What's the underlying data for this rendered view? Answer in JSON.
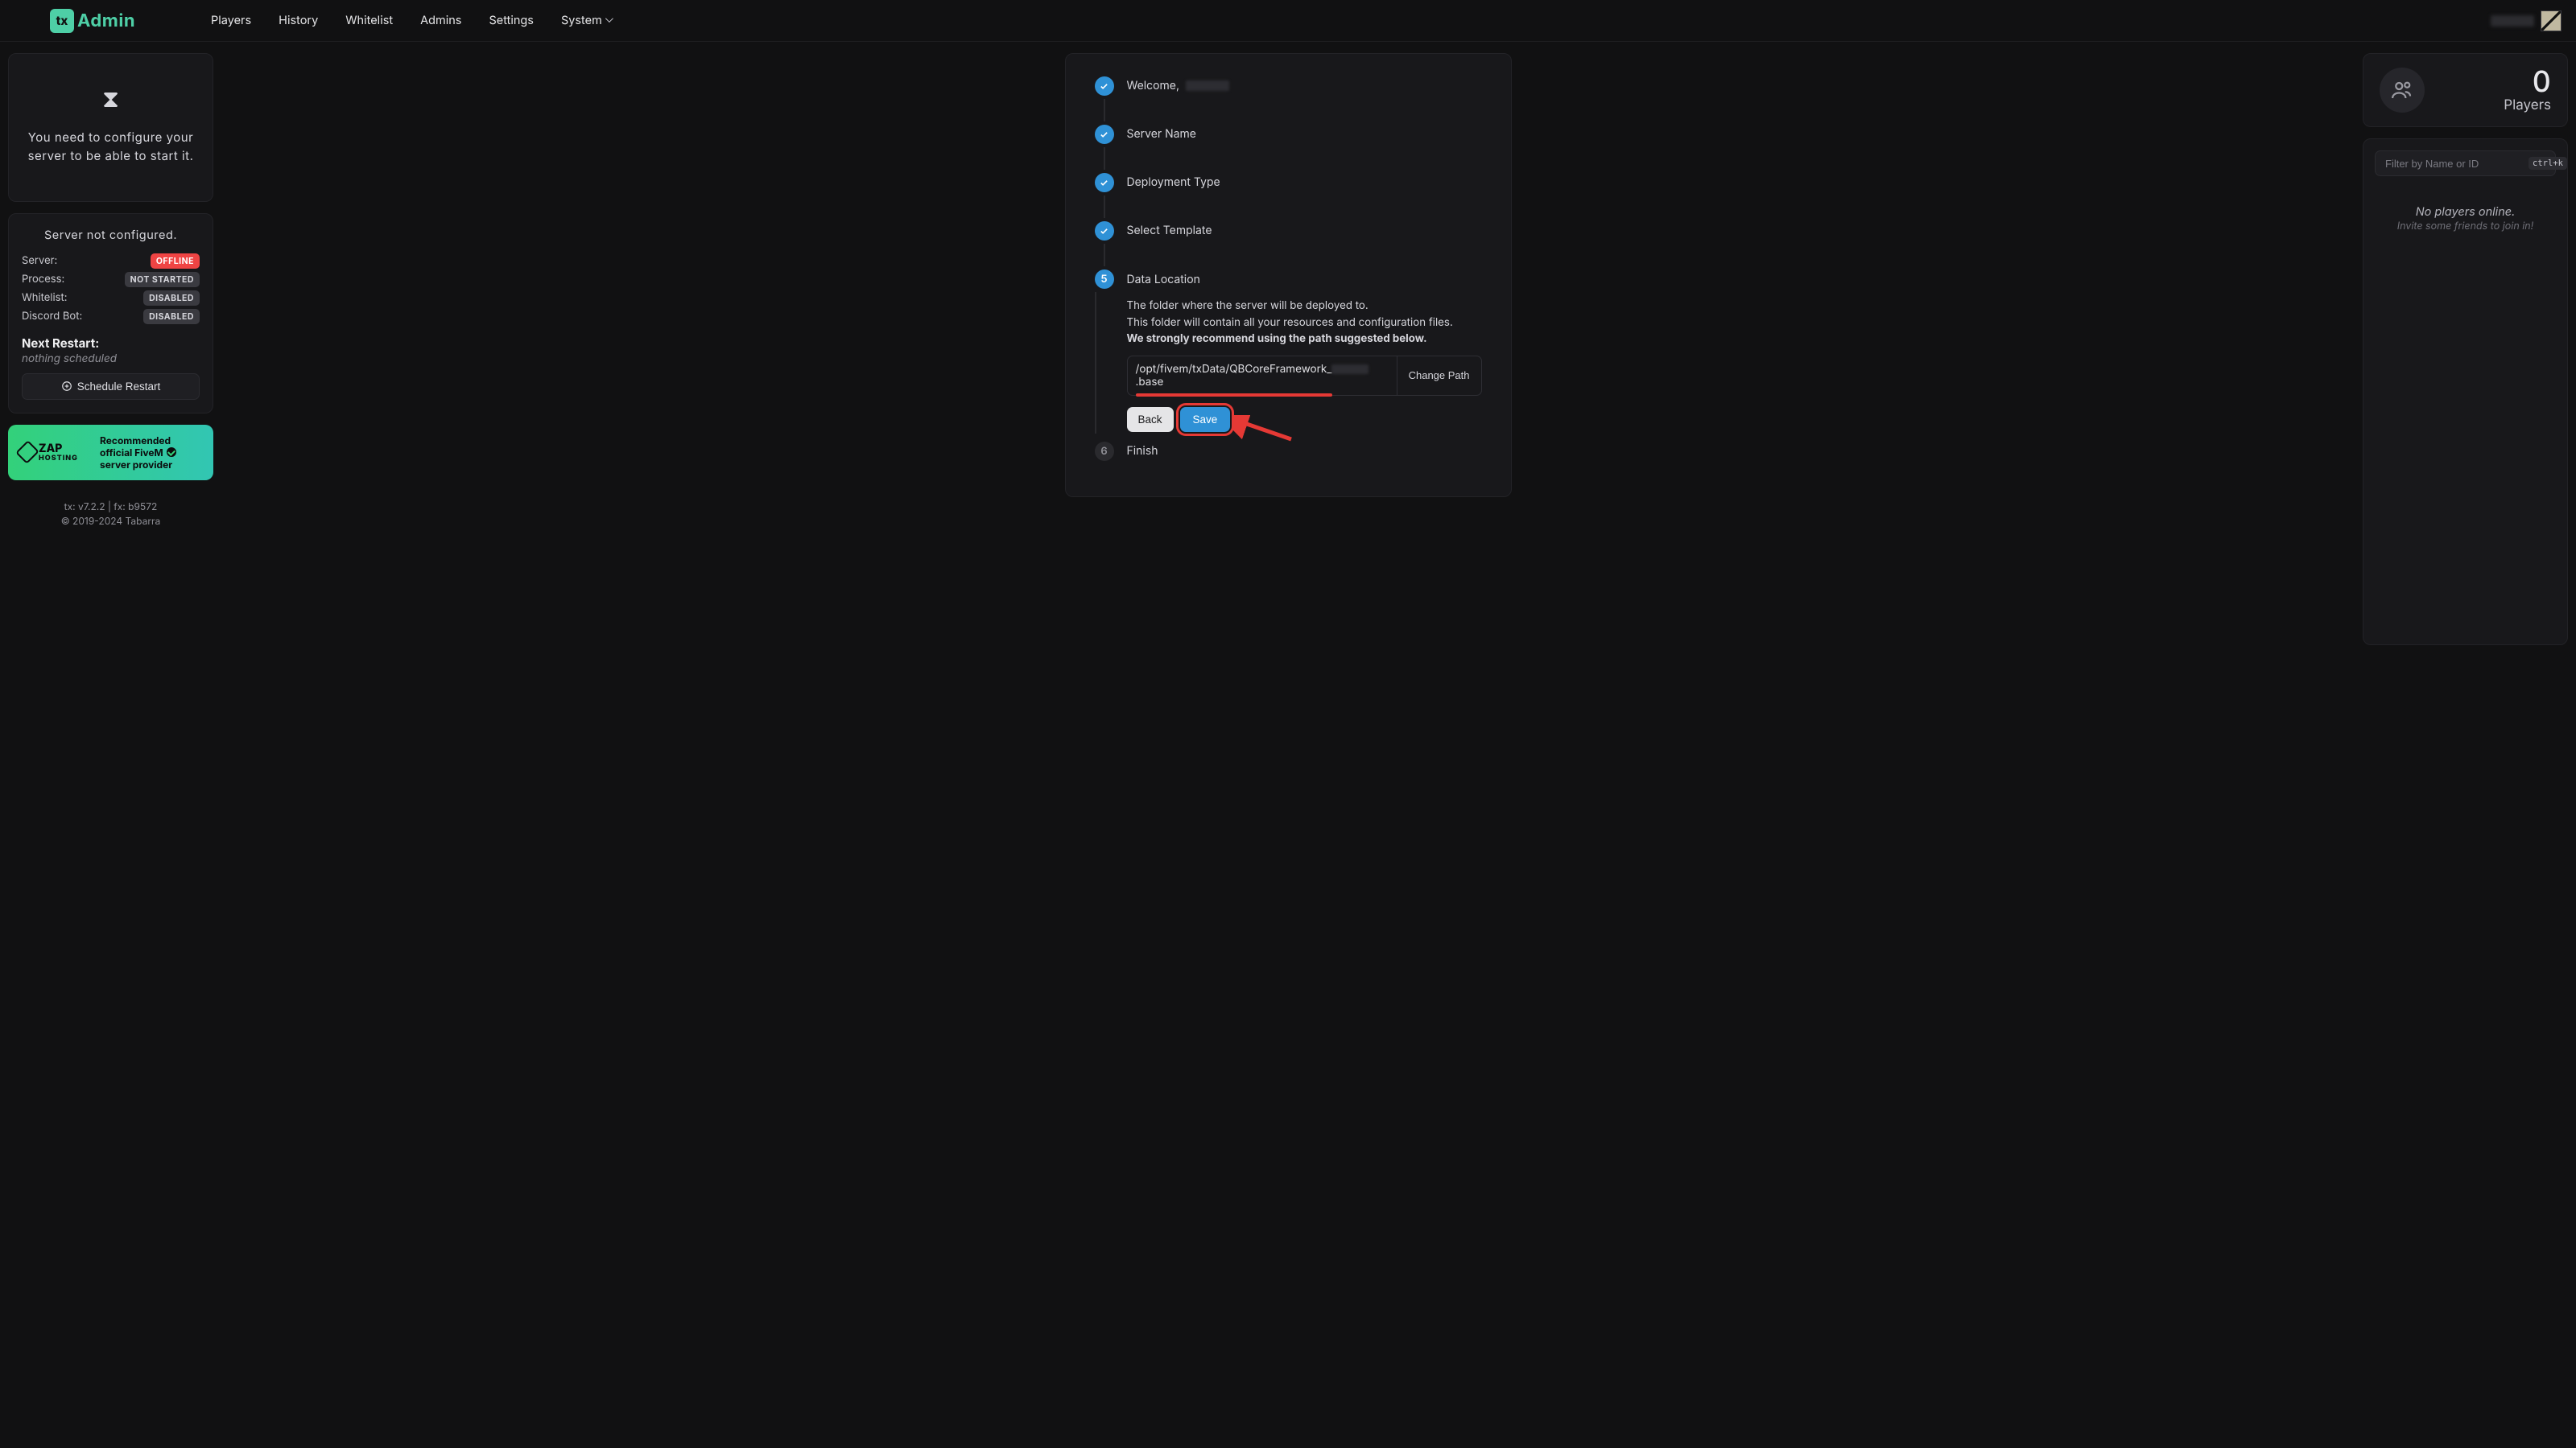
{
  "brand": {
    "mark": "tx",
    "name": "Admin"
  },
  "nav": {
    "players": "Players",
    "history": "History",
    "whitelist": "Whitelist",
    "admins": "Admins",
    "settings": "Settings",
    "system": "System"
  },
  "left": {
    "config_msg": "You need to configure your server to be able to start it.",
    "status_title": "Server not configured.",
    "rows": {
      "server": {
        "label": "Server:",
        "value": "OFFLINE"
      },
      "process": {
        "label": "Process:",
        "value": "NOT STARTED"
      },
      "whitelist": {
        "label": "Whitelist:",
        "value": "DISABLED"
      },
      "discord": {
        "label": "Discord Bot:",
        "value": "DISABLED"
      }
    },
    "next_restart_label": "Next Restart:",
    "next_restart_value": "nothing scheduled",
    "schedule_btn": "Schedule Restart",
    "zap": {
      "brand": "ZAP",
      "brand2": "HOSTING",
      "l1": "Recommended",
      "l2": "official FiveM",
      "l3": "server provider"
    },
    "footer": {
      "line1": "tx: v7.2.2 | fx: b9572",
      "line2": "© 2019-2024 Tabarra"
    }
  },
  "wizard": {
    "step1_prefix": "Welcome, ",
    "step2": "Server Name",
    "step3": "Deployment Type",
    "step4": "Select Template",
    "step5_n": "5",
    "step5": "Data Location",
    "step5_desc1": "The folder where the server will be deployed to.",
    "step5_desc2": "This folder will contain all your resources and configuration files.",
    "step5_desc3": "We strongly recommend using the path suggested below.",
    "path_prefix": "/opt/fivem/txData/QBCoreFramework_",
    "path_suffix": ".base",
    "change_path": "Change Path",
    "back": "Back",
    "save": "Save",
    "step6_n": "6",
    "step6": "Finish"
  },
  "right": {
    "players_count": "0",
    "players_label": "Players",
    "filter_placeholder": "Filter by Name or ID",
    "filter_kbd": "ctrl+k",
    "no_players_1": "No players online.",
    "no_players_2": "Invite some friends to join in!"
  }
}
